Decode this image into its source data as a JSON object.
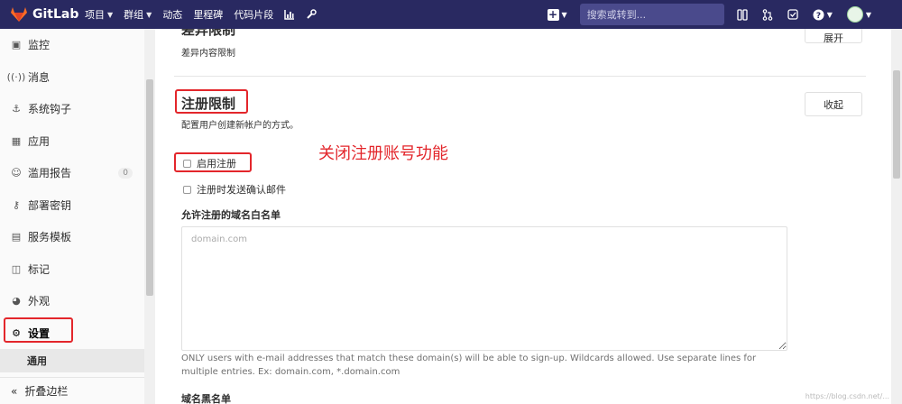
{
  "topnav": {
    "logo_text": "GitLab",
    "items": [
      {
        "label": "项目",
        "has_dropdown": true
      },
      {
        "label": "群组",
        "has_dropdown": true
      },
      {
        "label": "动态",
        "has_dropdown": false
      },
      {
        "label": "里程碑",
        "has_dropdown": false
      },
      {
        "label": "代码片段",
        "has_dropdown": false
      }
    ],
    "search_placeholder": "搜索或转到...",
    "colors": {
      "navbar": "#292961",
      "logo": "#fc6d26"
    }
  },
  "sidebar": {
    "items": [
      {
        "label": "监控",
        "icon": "monitor-icon"
      },
      {
        "label": "消息",
        "icon": "broadcast-icon"
      },
      {
        "label": "系统钩子",
        "icon": "hook-icon"
      },
      {
        "label": "应用",
        "icon": "apps-icon"
      },
      {
        "label": "滥用报告",
        "icon": "abuse-icon",
        "badge": "0"
      },
      {
        "label": "部署密钥",
        "icon": "key-icon"
      },
      {
        "label": "服务模板",
        "icon": "template-icon"
      },
      {
        "label": "标记",
        "icon": "labels-icon"
      },
      {
        "label": "外观",
        "icon": "appearance-icon"
      },
      {
        "label": "设置",
        "icon": "gear-icon",
        "active": true
      }
    ],
    "sub_item": "通用",
    "collapse_label": "折叠边栏"
  },
  "main": {
    "prev_section": {
      "title": "差异限制",
      "subtitle": "差异内容限制",
      "button": "展开"
    },
    "section": {
      "title": "注册限制",
      "subtitle": "配置用户创建新帐户的方式。",
      "button": "收起",
      "annotation": "关闭注册账号功能",
      "checkbox_signup": "启用注册",
      "checkbox_confirm": "注册时发送确认邮件",
      "whitelist_label": "允许注册的域名白名单",
      "whitelist_placeholder": "domain.com",
      "help_text": "ONLY users with e-mail addresses that match these domain(s) will be able to sign-up. Wildcards allowed. Use separate lines for multiple entries. Ex: domain.com, *.domain.com",
      "blacklist_label": "域名黑名单"
    }
  },
  "watermark": "https://blog.csdn.net/..."
}
